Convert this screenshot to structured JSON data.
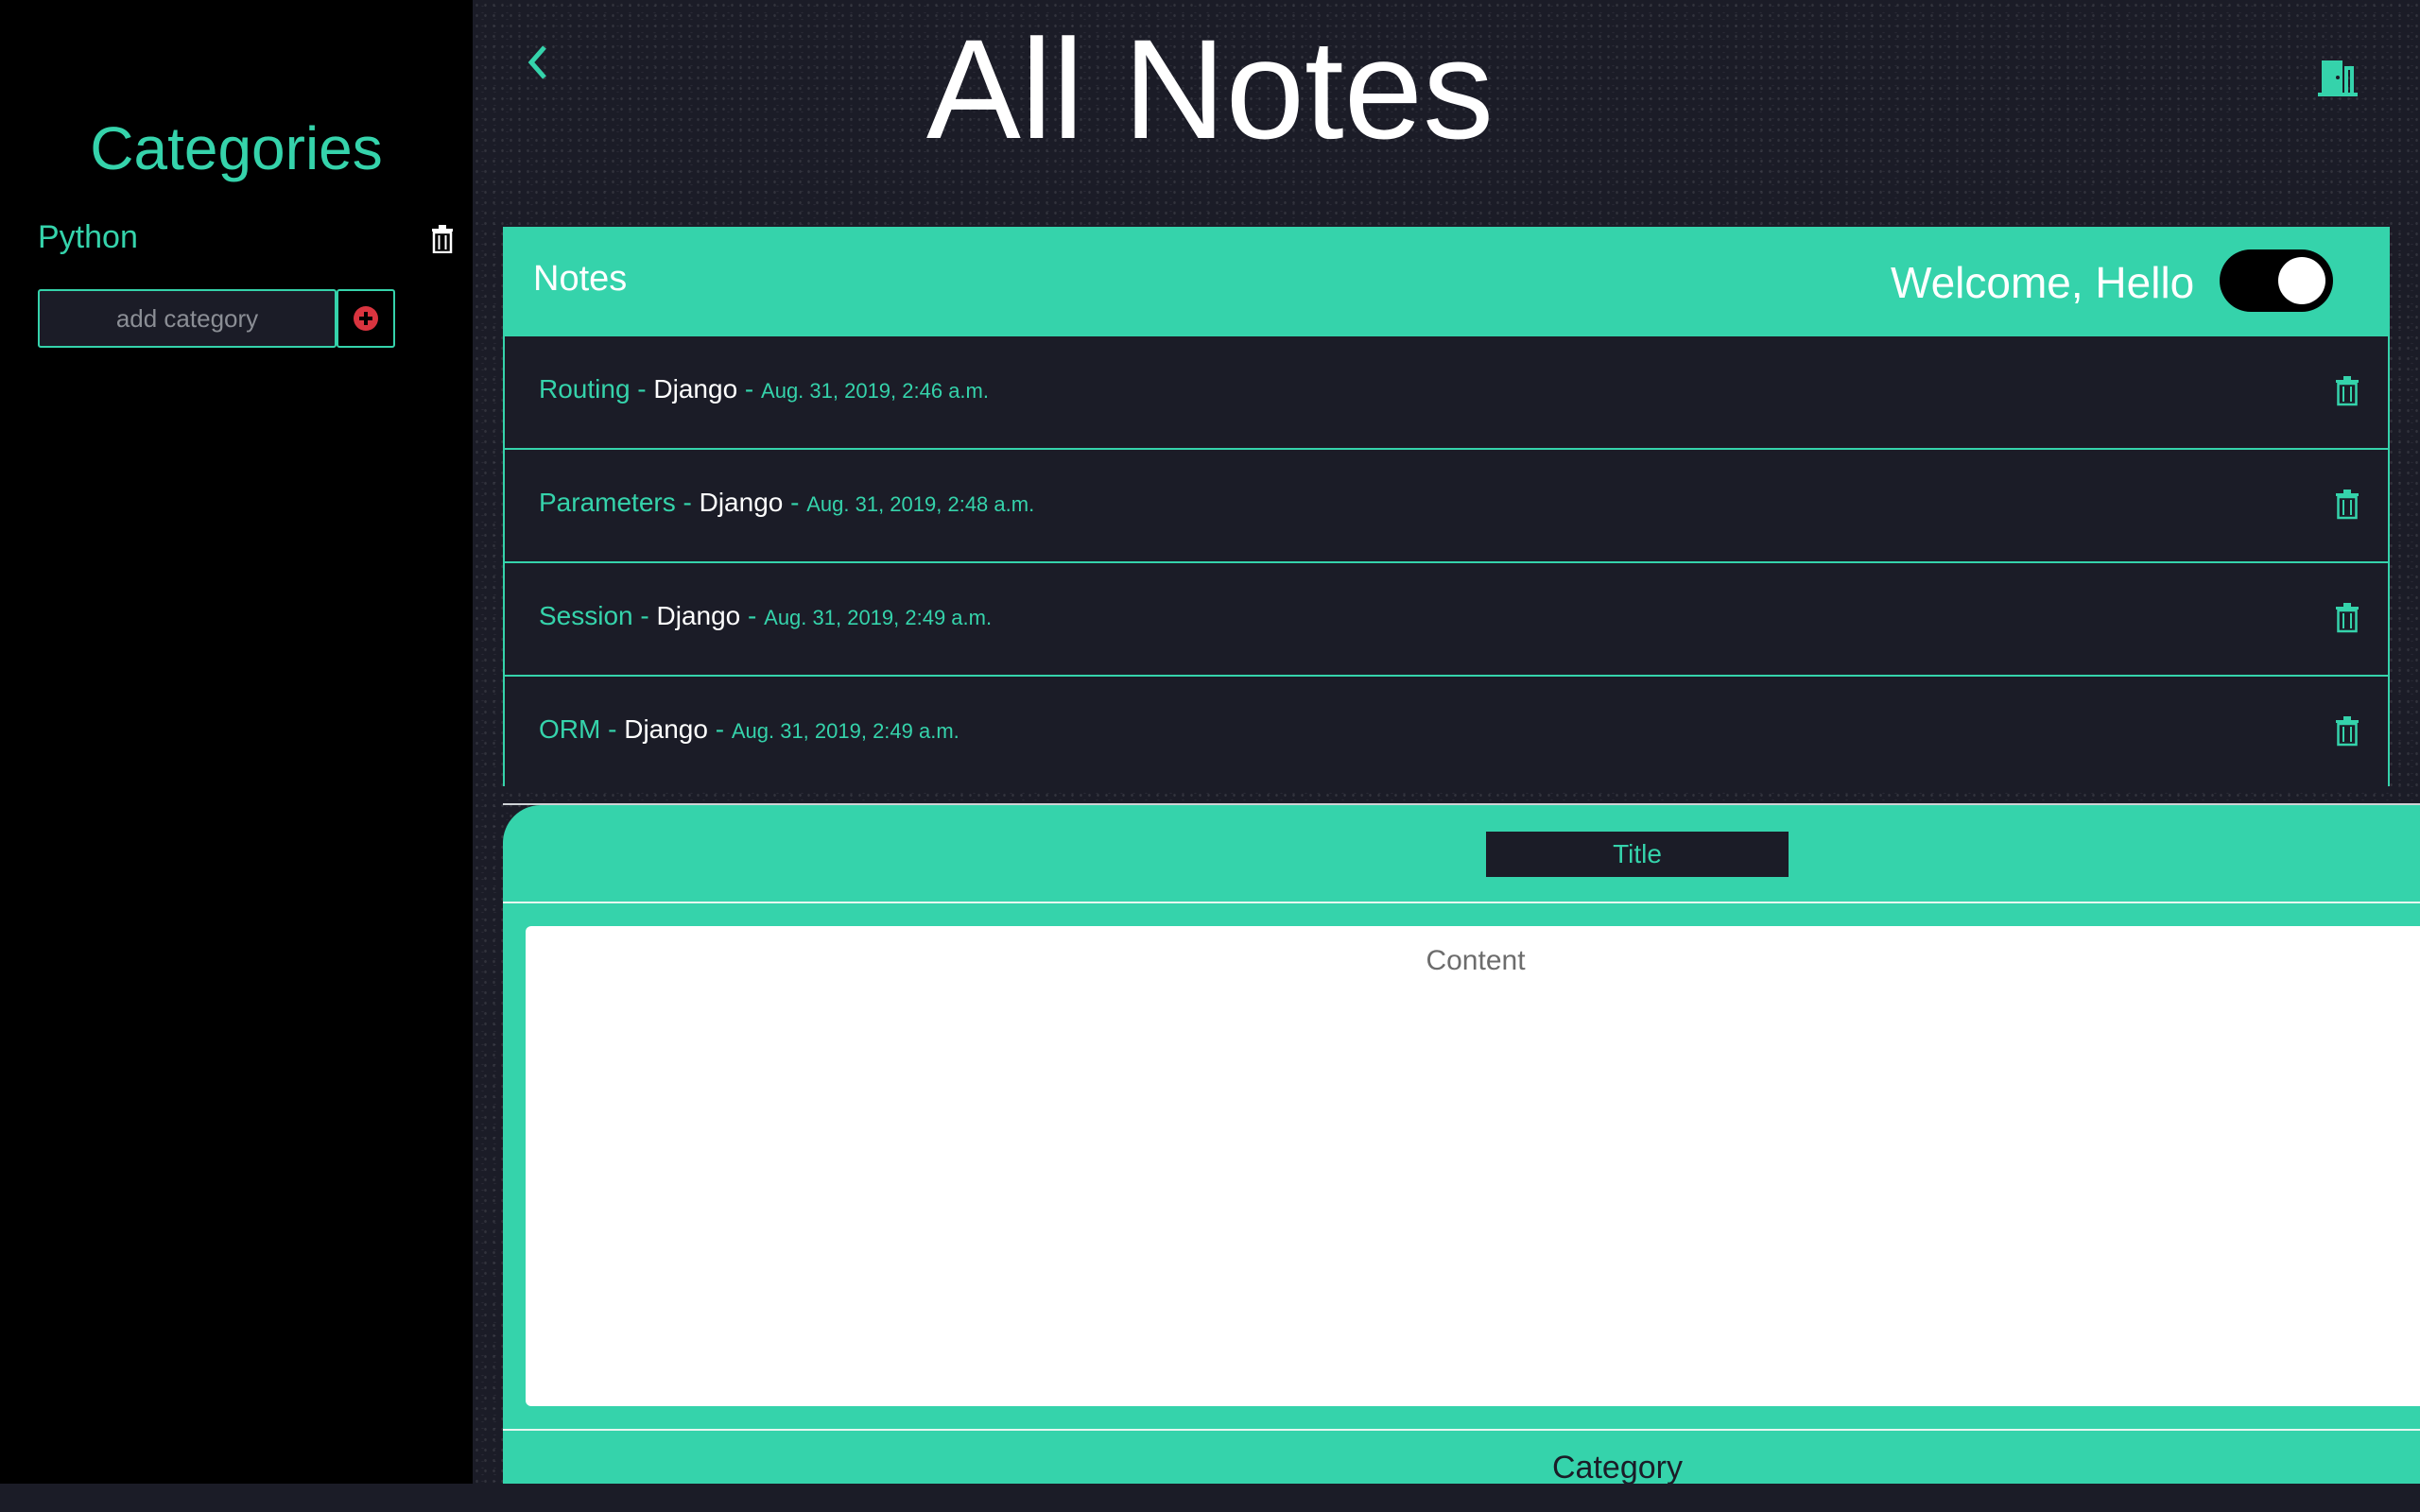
{
  "sidebar": {
    "title": "Categories",
    "categories": [
      {
        "label": "Python"
      }
    ],
    "add_category": {
      "placeholder": "add category"
    }
  },
  "header": {
    "title": "All Notes"
  },
  "notes_panel": {
    "label": "Notes",
    "welcome": "Welcome, Hello",
    "toggle_on": true,
    "separator": " - ",
    "notes": [
      {
        "title": "Routing",
        "category": "Django",
        "date": "Aug. 31, 2019, 2:46 a.m."
      },
      {
        "title": "Parameters",
        "category": "Django",
        "date": "Aug. 31, 2019, 2:48 a.m."
      },
      {
        "title": "Session",
        "category": "Django",
        "date": "Aug. 31, 2019, 2:49 a.m."
      },
      {
        "title": "ORM",
        "category": "Django",
        "date": "Aug. 31, 2019, 2:49 a.m."
      }
    ]
  },
  "editor": {
    "title_placeholder": "Title",
    "content_placeholder": "Content",
    "category_label": "Category"
  },
  "icons": {
    "back": "chevron-left-icon",
    "logout": "door-exit-icon",
    "trash": "trash-icon",
    "add": "plus-circle-icon"
  },
  "colors": {
    "accent": "#35d3ab",
    "background": "#1b1c27",
    "sidebar": "#000000",
    "add_icon": "#d9343f"
  }
}
